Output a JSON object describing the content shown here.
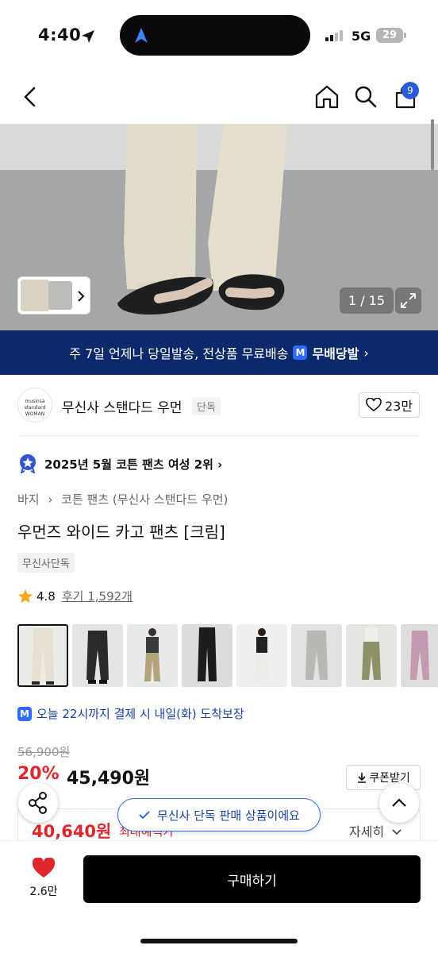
{
  "status_bar": {
    "time": "4:40",
    "network": "5G",
    "battery": "29"
  },
  "header": {
    "cart_count": "9",
    "icons": [
      "back-icon",
      "home-icon",
      "search-icon",
      "cart-icon"
    ]
  },
  "gallery": {
    "counter": "1 / 15"
  },
  "banner": {
    "text": "주 7일 언제나 당일발송, 전상품 무료배송",
    "badge": "M",
    "service": "무배당발",
    "arrow": "›"
  },
  "brand": {
    "logo_text": "musinsa standard WOMAN",
    "name": "무신사 스탠다드 우먼",
    "tag": "단독",
    "likes": "23만"
  },
  "ranking": {
    "text": "2025년 5월 코튼 팬츠 여성 2위",
    "arrow": "›"
  },
  "product": {
    "breadcrumb": [
      "바지",
      "코튼 팬츠 (무신사 스탠다드 우먼)"
    ],
    "breadcrumb_sep": "›",
    "title": "우먼즈 와이드 카고 팬츠 [크림]",
    "tag": "무신사단독",
    "rating": "4.8",
    "reviews": "후기 1,592개"
  },
  "delivery": {
    "badge": "M",
    "text": "오늘 22시까지 결제 시 내일(화) 도착보장"
  },
  "price": {
    "original": "56,900원",
    "discount": "20%",
    "current": "45,490원",
    "coupon": "쿠폰받기",
    "max_benefit": "40,640원",
    "max_label": "최대혜택가",
    "detail": "자세히"
  },
  "toast": {
    "text": "무신사 단독 판매 상품이에요"
  },
  "bottom": {
    "like_count": "2.6만",
    "buy_label": "구매하기"
  },
  "colors": {
    "accent_red": "#e0262d",
    "banner_navy": "#0c2a6b",
    "musinsa_blue": "#2f6bff",
    "badge_blue": "#2a5bd7"
  }
}
